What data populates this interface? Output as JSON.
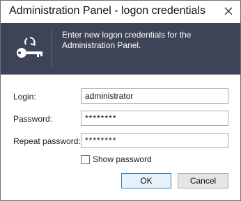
{
  "window": {
    "title": "Administration Panel - logon credentials",
    "close_icon": "close-icon"
  },
  "banner": {
    "icon": "key-refresh-icon",
    "text": "Enter new logon credentials for the Administration Panel."
  },
  "form": {
    "login_label": "Login:",
    "login_value": "administrator",
    "password_label": "Password:",
    "password_value": "********",
    "repeat_password_label": "Repeat password:",
    "repeat_password_value": "********",
    "show_password_label": "Show password",
    "show_password_checked": false
  },
  "buttons": {
    "ok_label": "OK",
    "cancel_label": "Cancel"
  },
  "colors": {
    "banner_bg": "#3e4457",
    "default_button_border": "#3c7fb1"
  }
}
